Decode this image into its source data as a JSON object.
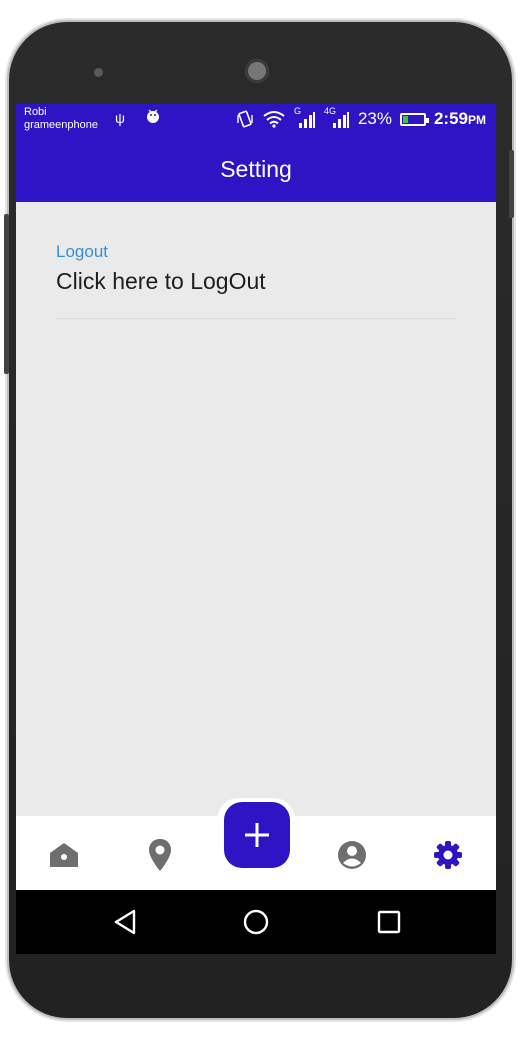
{
  "status_bar": {
    "carrier_line1": "Robi",
    "carrier_line2": "grameenphone",
    "signal1_label": "G",
    "signal2_label": "4G",
    "battery_percent": "23%",
    "battery_level": 0.23,
    "time": "2:59",
    "time_suffix": "PM"
  },
  "app_bar": {
    "title": "Setting"
  },
  "preferences": [
    {
      "title": "Logout",
      "summary": "Click here to LogOut"
    }
  ],
  "bottom_nav": {
    "items": [
      {
        "icon": "home-icon"
      },
      {
        "icon": "location-pin-icon"
      },
      {
        "icon": "add-icon"
      },
      {
        "icon": "account-circle-icon"
      },
      {
        "icon": "gear-icon",
        "active": true
      }
    ],
    "fab_label": "+"
  },
  "colors": {
    "primary": "#2d14c4",
    "pref_title": "#3a8fd2",
    "nav_inactive": "#6e6e6e",
    "nav_active": "#2d14c4",
    "background": "#eaeaea"
  }
}
